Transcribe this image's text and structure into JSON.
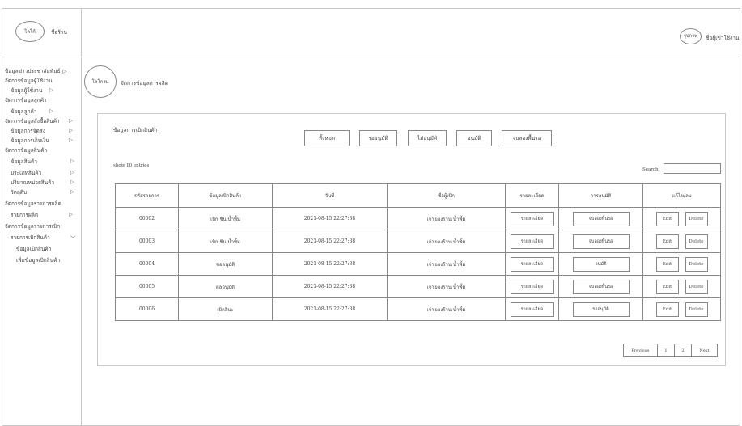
{
  "header": {
    "logo_label": "โลโก้",
    "store_name": "ชื่อร้าน",
    "avatar_label": "รูปภาพ",
    "user_name": "ชื่อผู้เข้าใช้งาน"
  },
  "sidebar": {
    "items": [
      {
        "label": "ข้อมูลข่าวประชาสัมพันธ์",
        "arrow": "▷"
      },
      {
        "label": "จัดการข้อมูลผู้ใช้งาน",
        "arrow": ""
      },
      {
        "label": "ข้อมูลผู้ใช้งาน",
        "arrow": "▷"
      },
      {
        "label": "จัดการข้อมูลลูกค้า",
        "arrow": ""
      },
      {
        "label": "ข้อมูลลูกค้า",
        "arrow": "▷"
      },
      {
        "label": "จัดการข้อมูลสั่งซื้อสินค้า",
        "arrow": "▷"
      },
      {
        "label": "ข้อมูลการจัดส่ง",
        "arrow": "▷"
      },
      {
        "label": "ข้อมูลการเก็บเงิน",
        "arrow": "▷"
      },
      {
        "label": "จัดการข้อมูลสินค้า",
        "arrow": ""
      },
      {
        "label": "ข้อมูลสินค้า",
        "arrow": "▷"
      },
      {
        "label": "ประเภทสินค้า",
        "arrow": "▷"
      },
      {
        "label": "ปริมาณหน่วยสินค้า",
        "arrow": "▷"
      },
      {
        "label": "วัตถุดิบ",
        "arrow": "▷"
      },
      {
        "label": "จัดการข้อมูลรายการผลิต",
        "arrow": ""
      },
      {
        "label": "รายการผลิต",
        "arrow": "▷"
      },
      {
        "label": "จัดการข้อมูลรายการเบิก",
        "arrow": ""
      },
      {
        "label": "รายการเบิกสินค้า",
        "arrow": "﹀"
      },
      {
        "label": "ข้อมูลเบิกสินค้า",
        "arrow": ""
      },
      {
        "label": "เพิ่มข้อมูลเบิกสินค้า",
        "arrow": ""
      }
    ]
  },
  "page": {
    "logo_label": "โลโกงน",
    "title": "จัดการข้อมูลการผลิต"
  },
  "card": {
    "title": "ข้อมูลการเบิกสินค้า",
    "filters": [
      "ทั้งหมด",
      "รออนุมัติ",
      "ไม่อนุมัติ",
      "อนุมัติ",
      "จบลองพื้นรอ"
    ],
    "show_entries": "show 10 entries",
    "search_label": "Search:"
  },
  "table": {
    "headers": [
      "รหัสรายการ",
      "ข้อมูลเบิกสินค้า",
      "วันที่",
      "ชื่อผู้เบิก",
      "รายละเอียด",
      "การอนุมัติ",
      "แก้ไข/ลบ"
    ],
    "rows": [
      {
        "id": "00002",
        "item": "เบิก ชิน น้ำพิ้ม",
        "date": "2021-08-15 22:27:38",
        "requester": "เจ้าของร้าน น้ำพิ้ม",
        "detail": "รายละเอียด",
        "approval": "จบลองพื้นรอ",
        "edit": "Edit",
        "delete": "Delete"
      },
      {
        "id": "00003",
        "item": "เบิก ชิน น้ำพิ้ม",
        "date": "2021-08-15 22:27:38",
        "requester": "เจ้าของร้าน น้ำพิ้ม",
        "detail": "รายละเอียด",
        "approval": "จบลองพื้นรอ",
        "edit": "Edit",
        "delete": "Delete"
      },
      {
        "id": "00004",
        "item": "ขออนุมัติ",
        "date": "2021-08-15 22:27:38",
        "requester": "เจ้าของร้าน น้ำพิ้ม",
        "detail": "รายละเอียด",
        "approval": "อนุมัติ",
        "edit": "Edit",
        "delete": "Delete"
      },
      {
        "id": "00005",
        "item": "ผลอนุมัติ",
        "date": "2021-08-15 22:27:38",
        "requester": "เจ้าของร้าน น้ำพิ้ม",
        "detail": "รายละเอียด",
        "approval": "จบลองพื้นรอ",
        "edit": "Edit",
        "delete": "Delete"
      },
      {
        "id": "00006",
        "item": "เบิกสินะ",
        "date": "2021-08-15 22:27:38",
        "requester": "เจ้าของร้าน น้ำพิ้ม",
        "detail": "รายละเอียด",
        "approval": "รออนุมัติ",
        "edit": "Edit",
        "delete": "Delete"
      }
    ]
  },
  "pagination": {
    "previous": "Previous",
    "pages": [
      "1",
      "2"
    ],
    "next": "Next"
  }
}
